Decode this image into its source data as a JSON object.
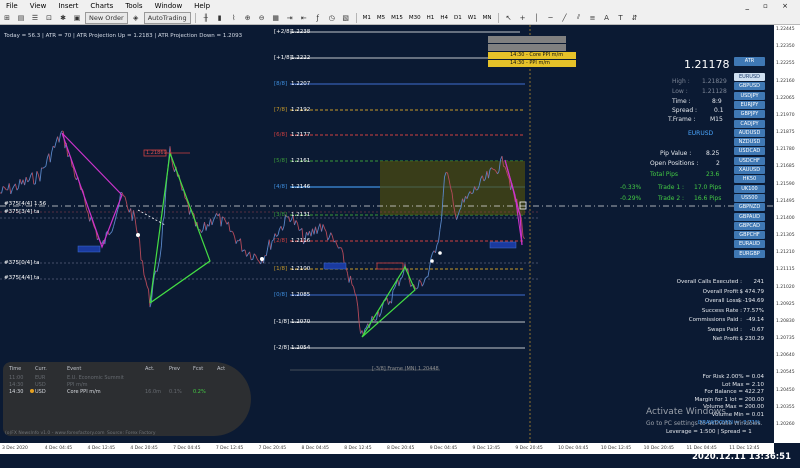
{
  "menu": {
    "items": [
      "File",
      "View",
      "Insert",
      "Charts",
      "Tools",
      "Window",
      "Help"
    ],
    "window_controls": "_ ▫ ×"
  },
  "toolbar": {
    "new_order": "New Order",
    "autotrading": "AutoTrading",
    "timeframes": [
      "M1",
      "M5",
      "M15",
      "M30",
      "H1",
      "H4",
      "D1",
      "W1",
      "MN"
    ]
  },
  "chart": {
    "info_line": "Today = 56.3  |  ATR = 70  |  ATR Projection Up = 1.2183  |  ATR Projection Down = 1.2093",
    "levels": [
      {
        "label": "[+2/8]",
        "price": "1.2238"
      },
      {
        "label": "[+1/8]",
        "price": "1.2222"
      },
      {
        "label": "[8/8]",
        "price": "1.2207"
      },
      {
        "label": "[7/8]",
        "price": "1.2192"
      },
      {
        "label": "[6/8]",
        "price": "1.2177"
      },
      {
        "label": "[5/8]",
        "price": "1.2161"
      },
      {
        "label": "[4/8]",
        "price": "1.2146"
      },
      {
        "label": "[3/8]",
        "price": "1.2131"
      },
      {
        "label": "[2/8]",
        "price": "1.2116"
      },
      {
        "label": "[1/8]",
        "price": "1.2100"
      },
      {
        "label": "[0/8]",
        "price": "1.2085"
      },
      {
        "label": "[-1/8]",
        "price": "1.2070"
      },
      {
        "label": "[-2/8]",
        "price": "1.2054"
      }
    ],
    "left_labels": [
      "#375[4/4]  1.56",
      "#375[3/4]  ta",
      "#375[0/4]  ta",
      "#375[4/4]  ta"
    ],
    "red_box_label": "1.21869",
    "level_footer": "[-3/8] Frame (MN)   1.20448",
    "trade_boxes": [
      "14:30 - Core PPI m/m",
      "14:30 - PPI m/m"
    ]
  },
  "panel": {
    "price": "1.21178",
    "atr_button": "ATR",
    "high_label": "High :",
    "high_value": "1.21829",
    "low_label": "Low :",
    "low_value": "1.21128",
    "time_label": "Time :",
    "time_value": "8:9",
    "spread_label": "Spread :",
    "spread_value": "0.1",
    "tframe_label": "T.Frame :",
    "tframe_value": "M15",
    "symbol": "EURUSD",
    "pip_value_label": "Pip Value :",
    "pip_value": "8.25",
    "open_positions_label": "Open Positions :",
    "open_positions": "2",
    "total_pips_label": "Total Pips",
    "total_pips": "23.6",
    "trade1_pct": "-0.33%",
    "trade1_label": "Trade 1 :",
    "trade1_pips": "17.0 Pips",
    "trade2_pct": "-0.29%",
    "trade2_label": "Trade 2 :",
    "trade2_pips": "16.6 Pips",
    "symbols": [
      "EURUSD",
      "GBPUSD",
      "USDJPY",
      "EURJPY",
      "GBPJPY",
      "CADJPY",
      "AUDUSD",
      "NZDUSD",
      "USDCAD",
      "USDCHF",
      "XAUUSD",
      "HK50",
      "UK100",
      "US500",
      "GBPNZD",
      "GBPAUD",
      "GBPCAD",
      "GBPCHF",
      "EURAUD",
      "EURGBP"
    ],
    "stats": [
      {
        "label": "Overall Calls Executed :",
        "value": "241"
      },
      {
        "label": "Overall Profit :",
        "value": "$ 474.79"
      },
      {
        "label": "Overall Loss :",
        "value": "$ -194.69"
      },
      {
        "label": "Success Rate :",
        "value": "77.57%"
      },
      {
        "label": "Commissions Paid :",
        "value": "-49.14"
      },
      {
        "label": "Swaps Paid :",
        "value": "-0.67"
      },
      {
        "label": "Net Profit :",
        "value": "$ 230.29"
      }
    ],
    "risk": [
      "For Risk 2.00% = 0.04",
      "Lot Max = 2.10",
      "For Balance = 422.27",
      "Margin for 1 lot = 200.00",
      "Volume Max = 200.00",
      "Volume Min = 0.01"
    ],
    "drawdown": "DRAWDOWN = -3.71%",
    "leverage": "Leverage = 1:500 | Spread = 1",
    "datetime": "2020.12.11 13:36:51"
  },
  "news": {
    "headers": [
      "Time",
      "Curr.",
      "Event",
      "Act.",
      "Prev",
      "Fcst",
      "Act"
    ],
    "rows": [
      {
        "time": "11:00",
        "curr": "EUR",
        "event": "E.U. Economic Summit",
        "act": "",
        "prev": "",
        "fcst": ""
      },
      {
        "time": "14:30",
        "curr": "USD",
        "event": "PPI m/m",
        "act": "",
        "prev": "",
        "fcst": ""
      },
      {
        "time": "14:30",
        "curr": "USD",
        "event": "Core PPI m/m",
        "act": "16.0m",
        "prev": "0.1%",
        "fcst": "0.2%"
      }
    ],
    "footer_left": "(o)FX NewsInfo v1.0  -  www.forexfactory.com",
    "footer_right": "Source: Forex Factory"
  },
  "watermark": {
    "title": "Activate Windows",
    "subtitle": "Go to PC settings to activate Windows."
  },
  "price_axis": [
    "1.22445",
    "1.22350",
    "1.22255",
    "1.22160",
    "1.22065",
    "1.21970",
    "1.21875",
    "1.21780",
    "1.21685",
    "1.21590",
    "1.21495",
    "1.21400",
    "1.21305",
    "1.21210",
    "1.21115",
    "1.21020",
    "1.20925",
    "1.20830",
    "1.20735",
    "1.20640",
    "1.20545",
    "1.20450",
    "1.20355",
    "1.20260"
  ],
  "time_axis": [
    "3 Dec 2020",
    "4 Dec 04:45",
    "4 Dec 12:45",
    "4 Dec 20:45",
    "7 Dec 04:45",
    "7 Dec 12:45",
    "7 Dec 20:45",
    "8 Dec 04:45",
    "8 Dec 12:45",
    "8 Dec 20:45",
    "9 Dec 04:45",
    "9 Dec 12:45",
    "9 Dec 20:45",
    "10 Dec 04:45",
    "10 Dec 12:45",
    "10 Dec 20:45",
    "11 Dec 04:45",
    "11 Dec 12:45"
  ]
}
